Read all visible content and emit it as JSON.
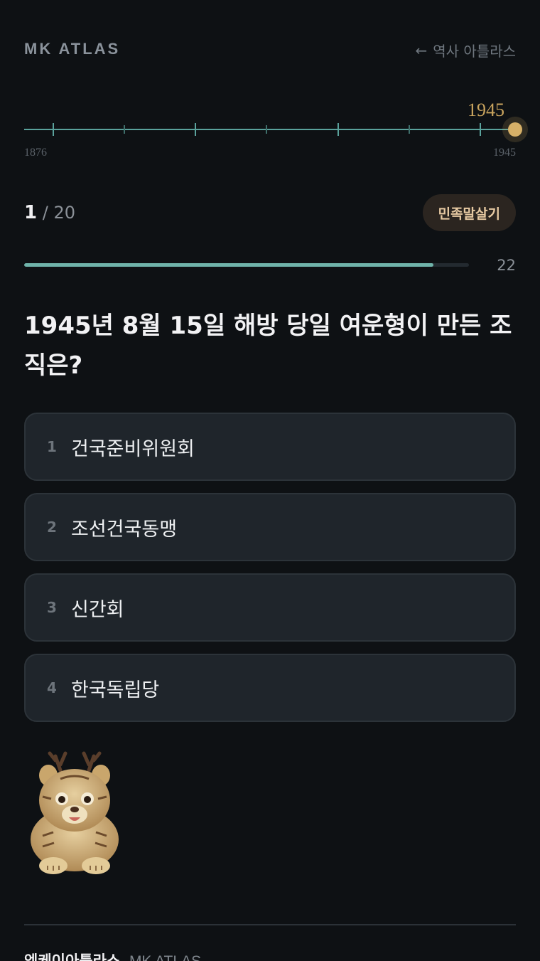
{
  "header": {
    "brand": "MK ATLAS",
    "back_arrow": "←",
    "back_label": "역사 아틀라스"
  },
  "timeline": {
    "start_year": "1876",
    "end_year": "1945",
    "current_year": "1945",
    "accent_color": "#c9a45e",
    "line_color": "#5aa29c"
  },
  "quiz": {
    "current": "1",
    "separator": "/",
    "total": "20",
    "category": "민족말살기",
    "timer": "22",
    "progress": 0.92,
    "question": "1945년 8월 15일 해방 당일 여운형이 만든 조직은?"
  },
  "answers": [
    {
      "num": "1",
      "text": "건국준비위원회"
    },
    {
      "num": "2",
      "text": "조선건국동맹"
    },
    {
      "num": "3",
      "text": "신간회"
    },
    {
      "num": "4",
      "text": "한국독립당"
    }
  ],
  "mascot": {
    "icon": "tiger-mascot"
  },
  "footer": {
    "title_ko": "엠케이아틀라스",
    "title_en": "MK ATLAS"
  }
}
